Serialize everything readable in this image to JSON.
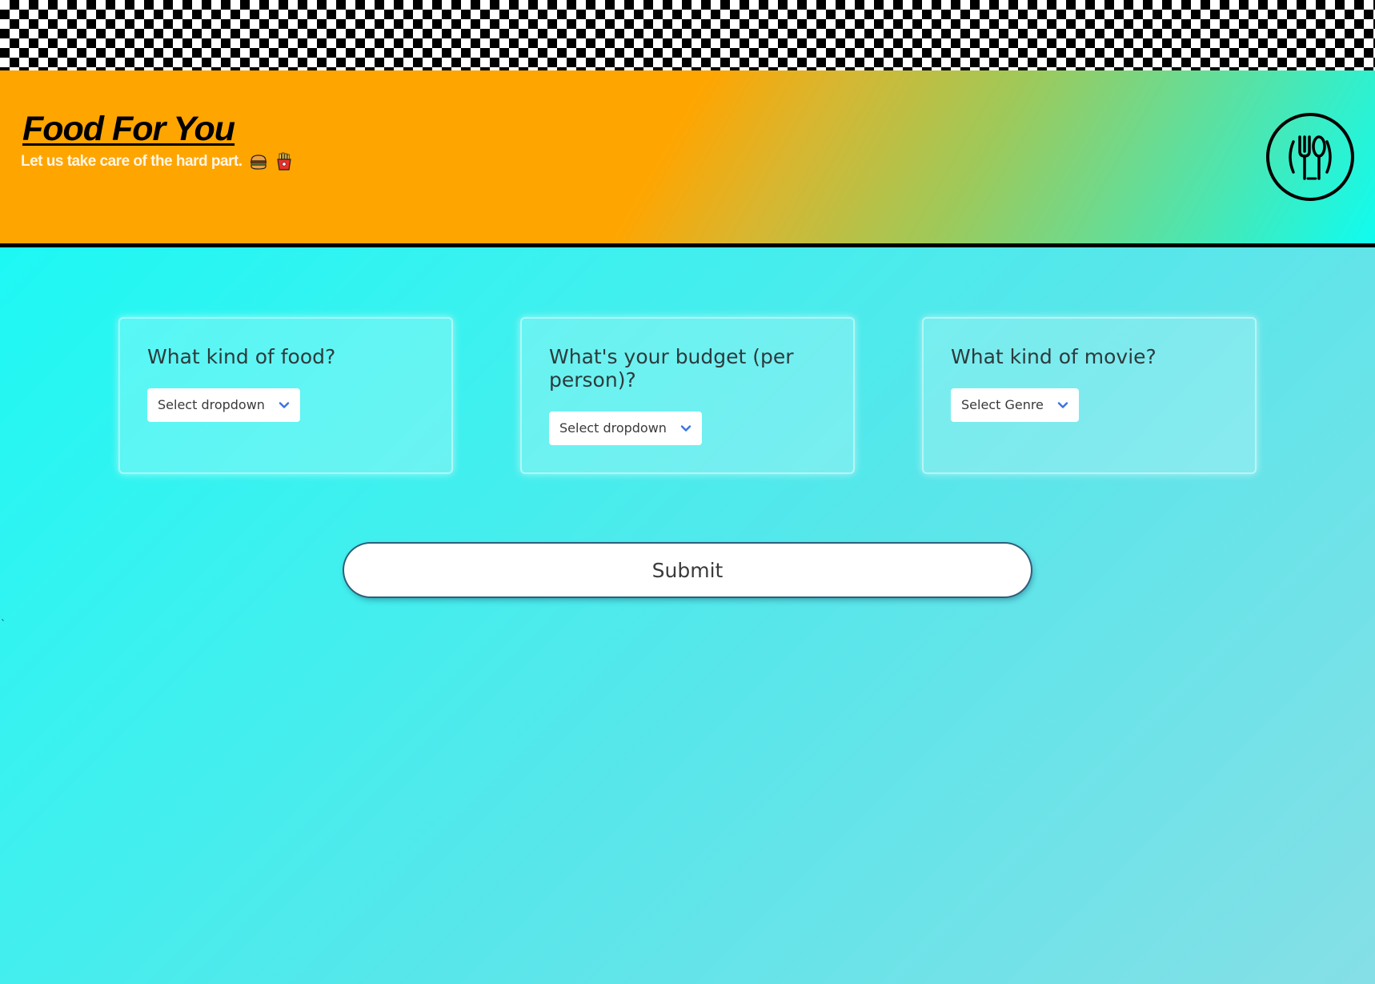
{
  "header": {
    "title": "Food For You",
    "tagline": "Let us take care of the hard part.",
    "emojis": [
      "burger-emoji",
      "fries-emoji"
    ],
    "logo_icon": "fork-spoon-plate-icon",
    "accent_colors": {
      "orange": "#ffa500",
      "cyan": "#0ffcf0"
    }
  },
  "questions": [
    {
      "question": "What kind of food?",
      "select_value": "Select dropdown"
    },
    {
      "question": "What's your budget (per person)?",
      "select_value": "Select dropdown"
    },
    {
      "question": "What kind of movie?",
      "select_value": "Select Genre"
    }
  ],
  "submit": {
    "label": "Submit"
  },
  "stray_text": "`",
  "icons": {
    "chevron": "chevron-down-icon"
  },
  "colors": {
    "chevron": "#3b74e0",
    "text": "#2d3b3d"
  }
}
